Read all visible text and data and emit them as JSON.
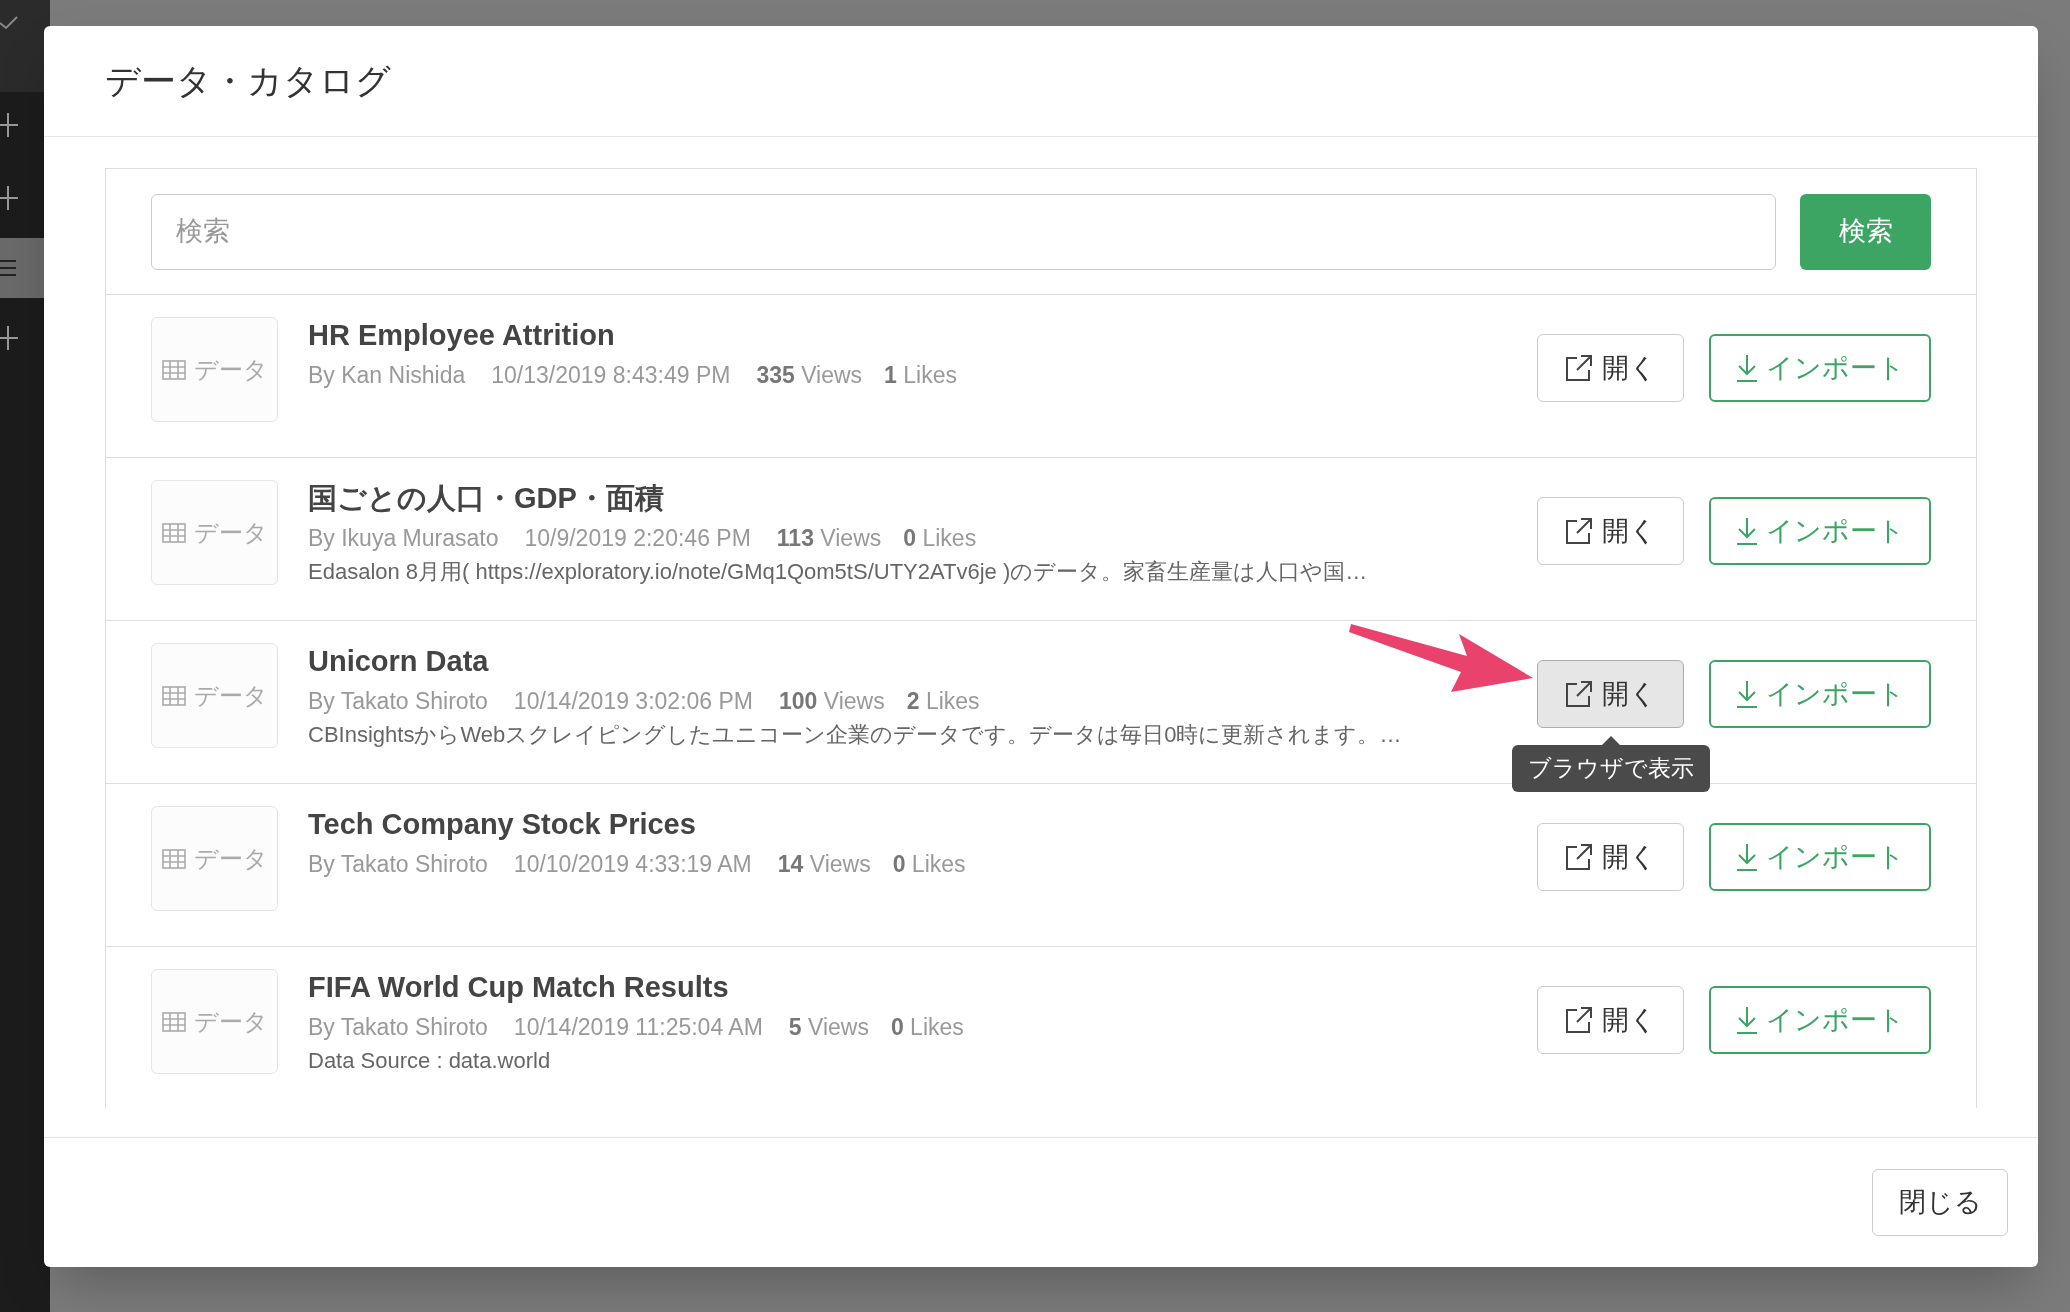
{
  "dialog": {
    "title": "データ・カタログ"
  },
  "search": {
    "placeholder": "検索",
    "button": "検索"
  },
  "items": [
    {
      "thumb": "データ",
      "title": "HR Employee Attrition",
      "author": "By Kan Nishida",
      "date": "10/13/2019 8:43:49 PM",
      "views": "**335** Views",
      "likes": "**1** Likes",
      "open": "開く",
      "import": "インポート",
      "hovered": false
    },
    {
      "thumb": "データ",
      "title": "国ごとの人口・GDP・面積",
      "author": "By Ikuya Murasato",
      "date": "10/9/2019 2:20:46 PM",
      "views": "**113** Views",
      "likes": "**0** Likes",
      "description": "Edasalon 8月用( https://exploratory.io/note/GMq1Qom5tS/UTY2ATv6je )のデータ。家畜生産量は人口や国…",
      "open": "開く",
      "import": "インポート",
      "hovered": false
    },
    {
      "thumb": "データ",
      "title": "Unicorn Data",
      "author": "By Takato Shiroto",
      "date": "10/14/2019 3:02:06 PM",
      "views": "**100** Views",
      "likes": "**2** Likes",
      "description": "CBInsightsからWebスクレイピングしたユニコーン企業のデータです。データは毎日0時に更新されます。…",
      "open": "開く",
      "import": "インポート",
      "hovered": true,
      "tooltip": "ブラウザで表示"
    },
    {
      "thumb": "データ",
      "title": "Tech Company Stock Prices",
      "author": "By Takato Shiroto",
      "date": "10/10/2019 4:33:19 AM",
      "views": "**14** Views",
      "likes": "**0** Likes",
      "open": "開く",
      "import": "インポート",
      "hovered": false
    },
    {
      "thumb": "データ",
      "title": "FIFA World Cup Match Results",
      "author": "By Takato Shiroto",
      "date": "10/14/2019 11:25:04 AM",
      "views": "**5** Views",
      "likes": "**0** Likes",
      "description": "Data Source : data.world",
      "open": "開く",
      "import": "インポート",
      "hovered": false
    }
  ],
  "footer": {
    "close": "閉じる"
  }
}
